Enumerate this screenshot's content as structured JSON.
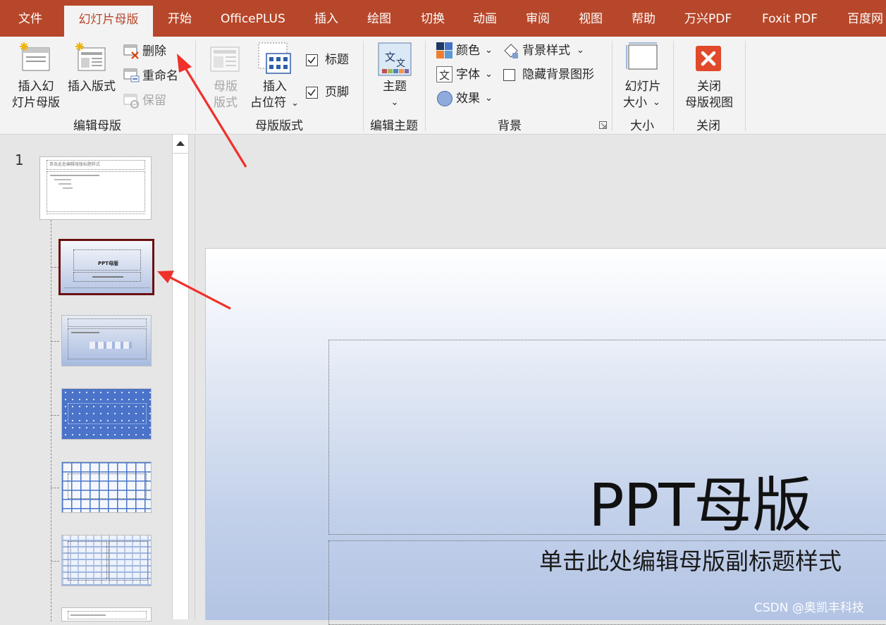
{
  "tabs": [
    "文件",
    "幻灯片母版",
    "开始",
    "OfficePLUS",
    "插入",
    "绘图",
    "切换",
    "动画",
    "审阅",
    "视图",
    "帮助",
    "万兴PDF",
    "Foxit PDF",
    "百度网"
  ],
  "ribbon": {
    "edit_master": {
      "insert_slide_master": [
        "插入幻",
        "灯片母版"
      ],
      "insert_layout": "插入版式",
      "delete": "删除",
      "rename": "重命名",
      "preserve": "保留",
      "group_label": "编辑母版"
    },
    "master_layout": {
      "master_layout_btn": [
        "母版",
        "版式"
      ],
      "insert_placeholder": [
        "插入",
        "占位符"
      ],
      "title_checkbox": "标题",
      "footer_checkbox": "页脚",
      "group_label": "母版版式"
    },
    "edit_theme": {
      "themes": "主题",
      "group_label": "编辑主题"
    },
    "background": {
      "colors": "颜色",
      "fonts": "字体",
      "effects": "效果",
      "background_styles": "背景样式",
      "hide_background_graphics": "隐藏背景图形",
      "group_label": "背景"
    },
    "size": {
      "slide_size": [
        "幻灯片",
        "大小"
      ],
      "group_label": "大小"
    },
    "close": {
      "close_master_view": [
        "关闭",
        "母版视图"
      ],
      "group_label": "关闭"
    }
  },
  "thumbnails": {
    "slide_number": "1",
    "master_thumb_title": "单击此处编辑母版标题样式",
    "layout_thumb_title": "PPT母版"
  },
  "slide": {
    "title": "PPT母版",
    "subtitle": "单击此处编辑母版副标题样式"
  },
  "watermark": "CSDN @奥凯丰科技",
  "colors": {
    "accent": "#b7472a",
    "selected_border": "#6b0f0f",
    "arrow": "#f0302a"
  }
}
